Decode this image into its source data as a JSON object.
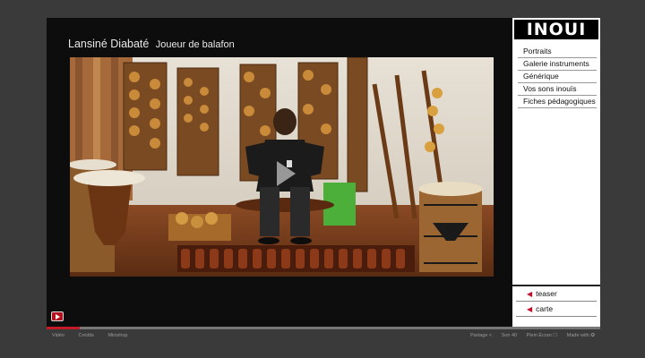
{
  "header": {
    "name": "Lansiné Diabaté",
    "role": "Joueur de balafon"
  },
  "logo": "INOUI",
  "nav": [
    {
      "label": "Portraits"
    },
    {
      "label": "Galerie instruments"
    },
    {
      "label": "Générique"
    },
    {
      "label": "Vos sons inouïs"
    },
    {
      "label": "Fiches pédagogiques"
    }
  ],
  "bottom_nav": [
    {
      "label": "teaser",
      "icon": "chevron-left-icon"
    },
    {
      "label": "carte",
      "icon": "chevron-left-icon"
    }
  ],
  "player": {
    "progress": 0.06
  },
  "footer": {
    "left": [
      "Vidéo",
      "Crédits",
      "Minishop"
    ],
    "right": [
      "Partage <",
      "Son 40",
      "Plein Écran ☐",
      "Made with ✪"
    ]
  },
  "colors": {
    "accent": "#c41a28",
    "page_bg": "#3a3a3a",
    "stage_bg": "#0d0d0d"
  }
}
